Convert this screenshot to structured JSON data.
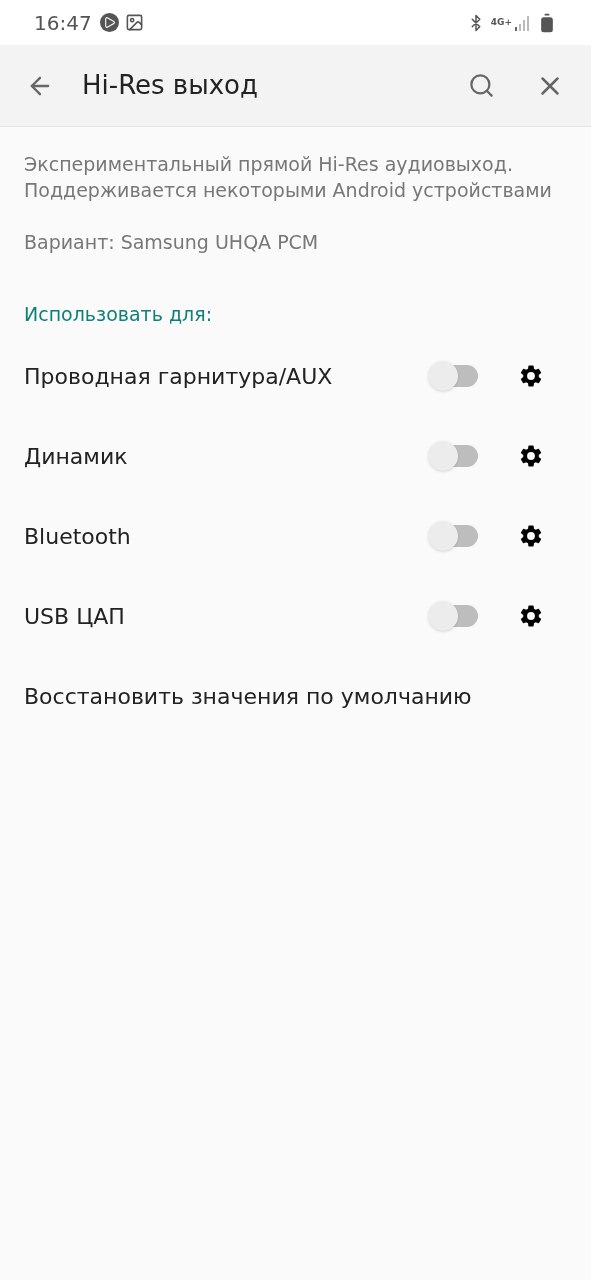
{
  "status_bar": {
    "time": "16:47",
    "network": "4G+"
  },
  "app_bar": {
    "title": "Hi-Res выход"
  },
  "description": "Экспериментальный прямой Hi-Res аудиовыход. Поддерживается некоторыми Android устройствами",
  "variant": "Вариант: Samsung UHQA PCM",
  "section_header": "Использовать для:",
  "outputs": [
    {
      "label": "Проводная гарнитура/AUX",
      "on": false
    },
    {
      "label": "Динамик",
      "on": false
    },
    {
      "label": "Bluetooth",
      "on": false
    },
    {
      "label": "USB ЦАП",
      "on": false
    }
  ],
  "reset": "Восстановить значения по умолчанию"
}
